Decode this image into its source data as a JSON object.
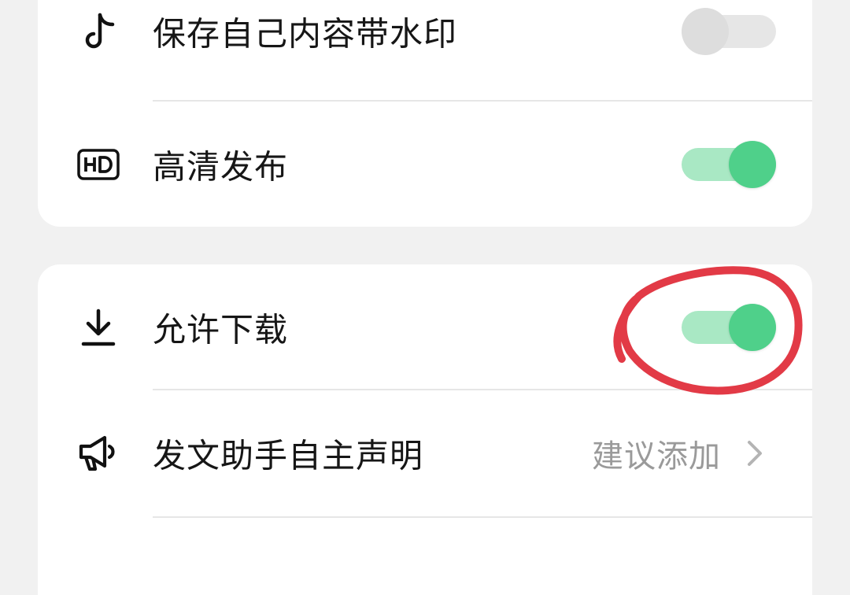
{
  "settings_group_1": {
    "items": [
      {
        "icon": "tiktok-note-icon",
        "label": "保存自己内容带水印",
        "toggle_on": false
      },
      {
        "icon": "hd-icon",
        "label": "高清发布",
        "toggle_on": true
      }
    ]
  },
  "settings_group_2": {
    "items": [
      {
        "icon": "download-icon",
        "label": "允许下载",
        "toggle_on": true
      },
      {
        "icon": "megaphone-icon",
        "label": "发文助手自主声明",
        "value": "建议添加",
        "trailing_icon": "chevron-right-icon"
      }
    ]
  },
  "annotation": {
    "shape": "hand-drawn-circle",
    "color": "#e23a46"
  },
  "colors": {
    "background": "#f1f1f1",
    "card": "#ffffff",
    "toggle_on_track": "#a9e8c4",
    "toggle_on_knob": "#4fd08a",
    "toggle_off": "#e2e2e2",
    "secondary_text": "#9a9a9a"
  }
}
